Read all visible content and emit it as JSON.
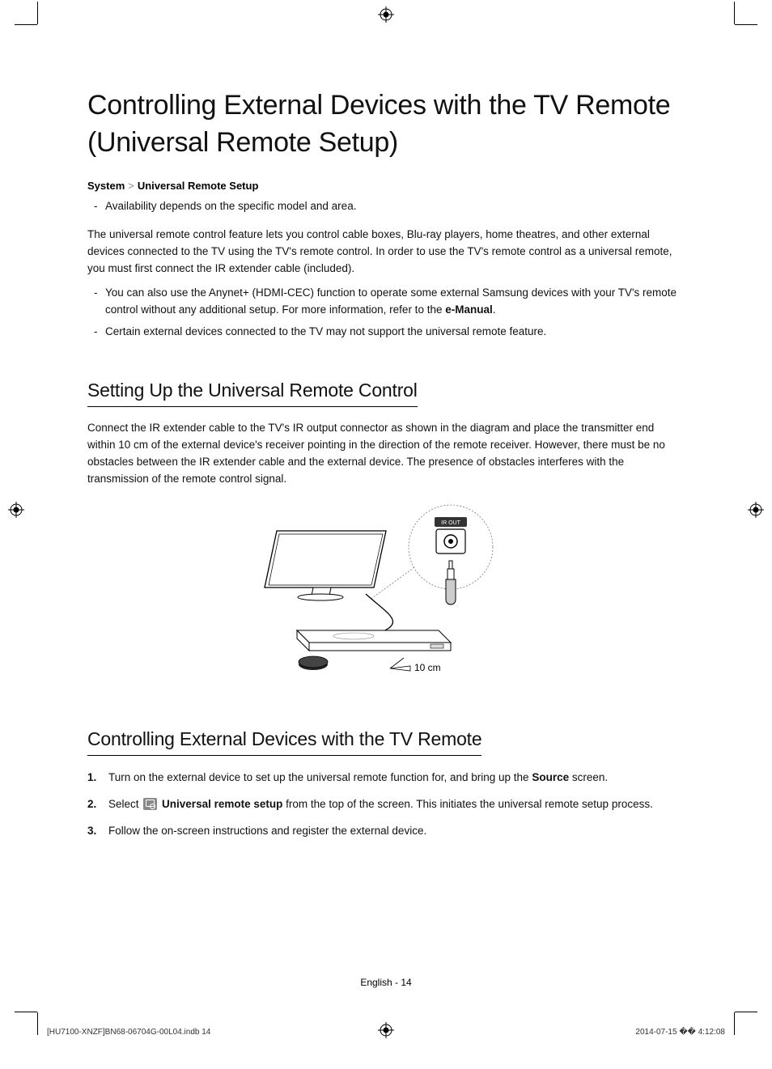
{
  "title": "Controlling External Devices with the TV Remote (Universal Remote Setup)",
  "breadcrumb": {
    "a": "System",
    "b": "Universal Remote Setup"
  },
  "intro_bullets": [
    "Availability depends on the specific model and area."
  ],
  "intro_p": "The universal remote control feature lets you control cable boxes, Blu-ray players, home theatres, and other external devices connected to the TV using the TV's remote control. In order to use the TV's remote control as a universal remote, you must first connect the IR extender cable (included).",
  "notes": {
    "n1a": "You can also use the Anynet+ (HDMI-CEC) function to operate some external Samsung devices with your TV's remote control without any additional setup. For more information, refer to the ",
    "n1b": "e-Manual",
    "n1c": ".",
    "n2": "Certain external devices connected to the TV may not support the universal remote feature."
  },
  "section1": {
    "title": "Setting Up the Universal Remote Control",
    "p": "Connect the IR extender cable to the TV's IR output connector as shown in the diagram and place the transmitter end within 10 cm of the external device's receiver pointing in the direction of the remote receiver. However, there must be no obstacles between the IR extender cable and the external device. The presence of obstacles interferes with the transmission of the remote control signal."
  },
  "diagram": {
    "irout_label": "IR OUT",
    "distance": "10 cm"
  },
  "section2": {
    "title": "Controlling External Devices with the TV Remote",
    "step1a": "Turn on the external device to set up the universal remote function for, and bring up the ",
    "step1b": "Source",
    "step1c": " screen.",
    "step2a": "Select ",
    "step2b": "Universal remote setup",
    "step2c": " from the top of the screen. This initiates the universal remote setup process.",
    "step3": "Follow the on-screen instructions and register the external device."
  },
  "footer": {
    "center": "English - 14",
    "left": "[HU7100-XNZF]BN68-06704G-00L04.indb   14",
    "right": "2014-07-15   �� 4:12:08"
  }
}
